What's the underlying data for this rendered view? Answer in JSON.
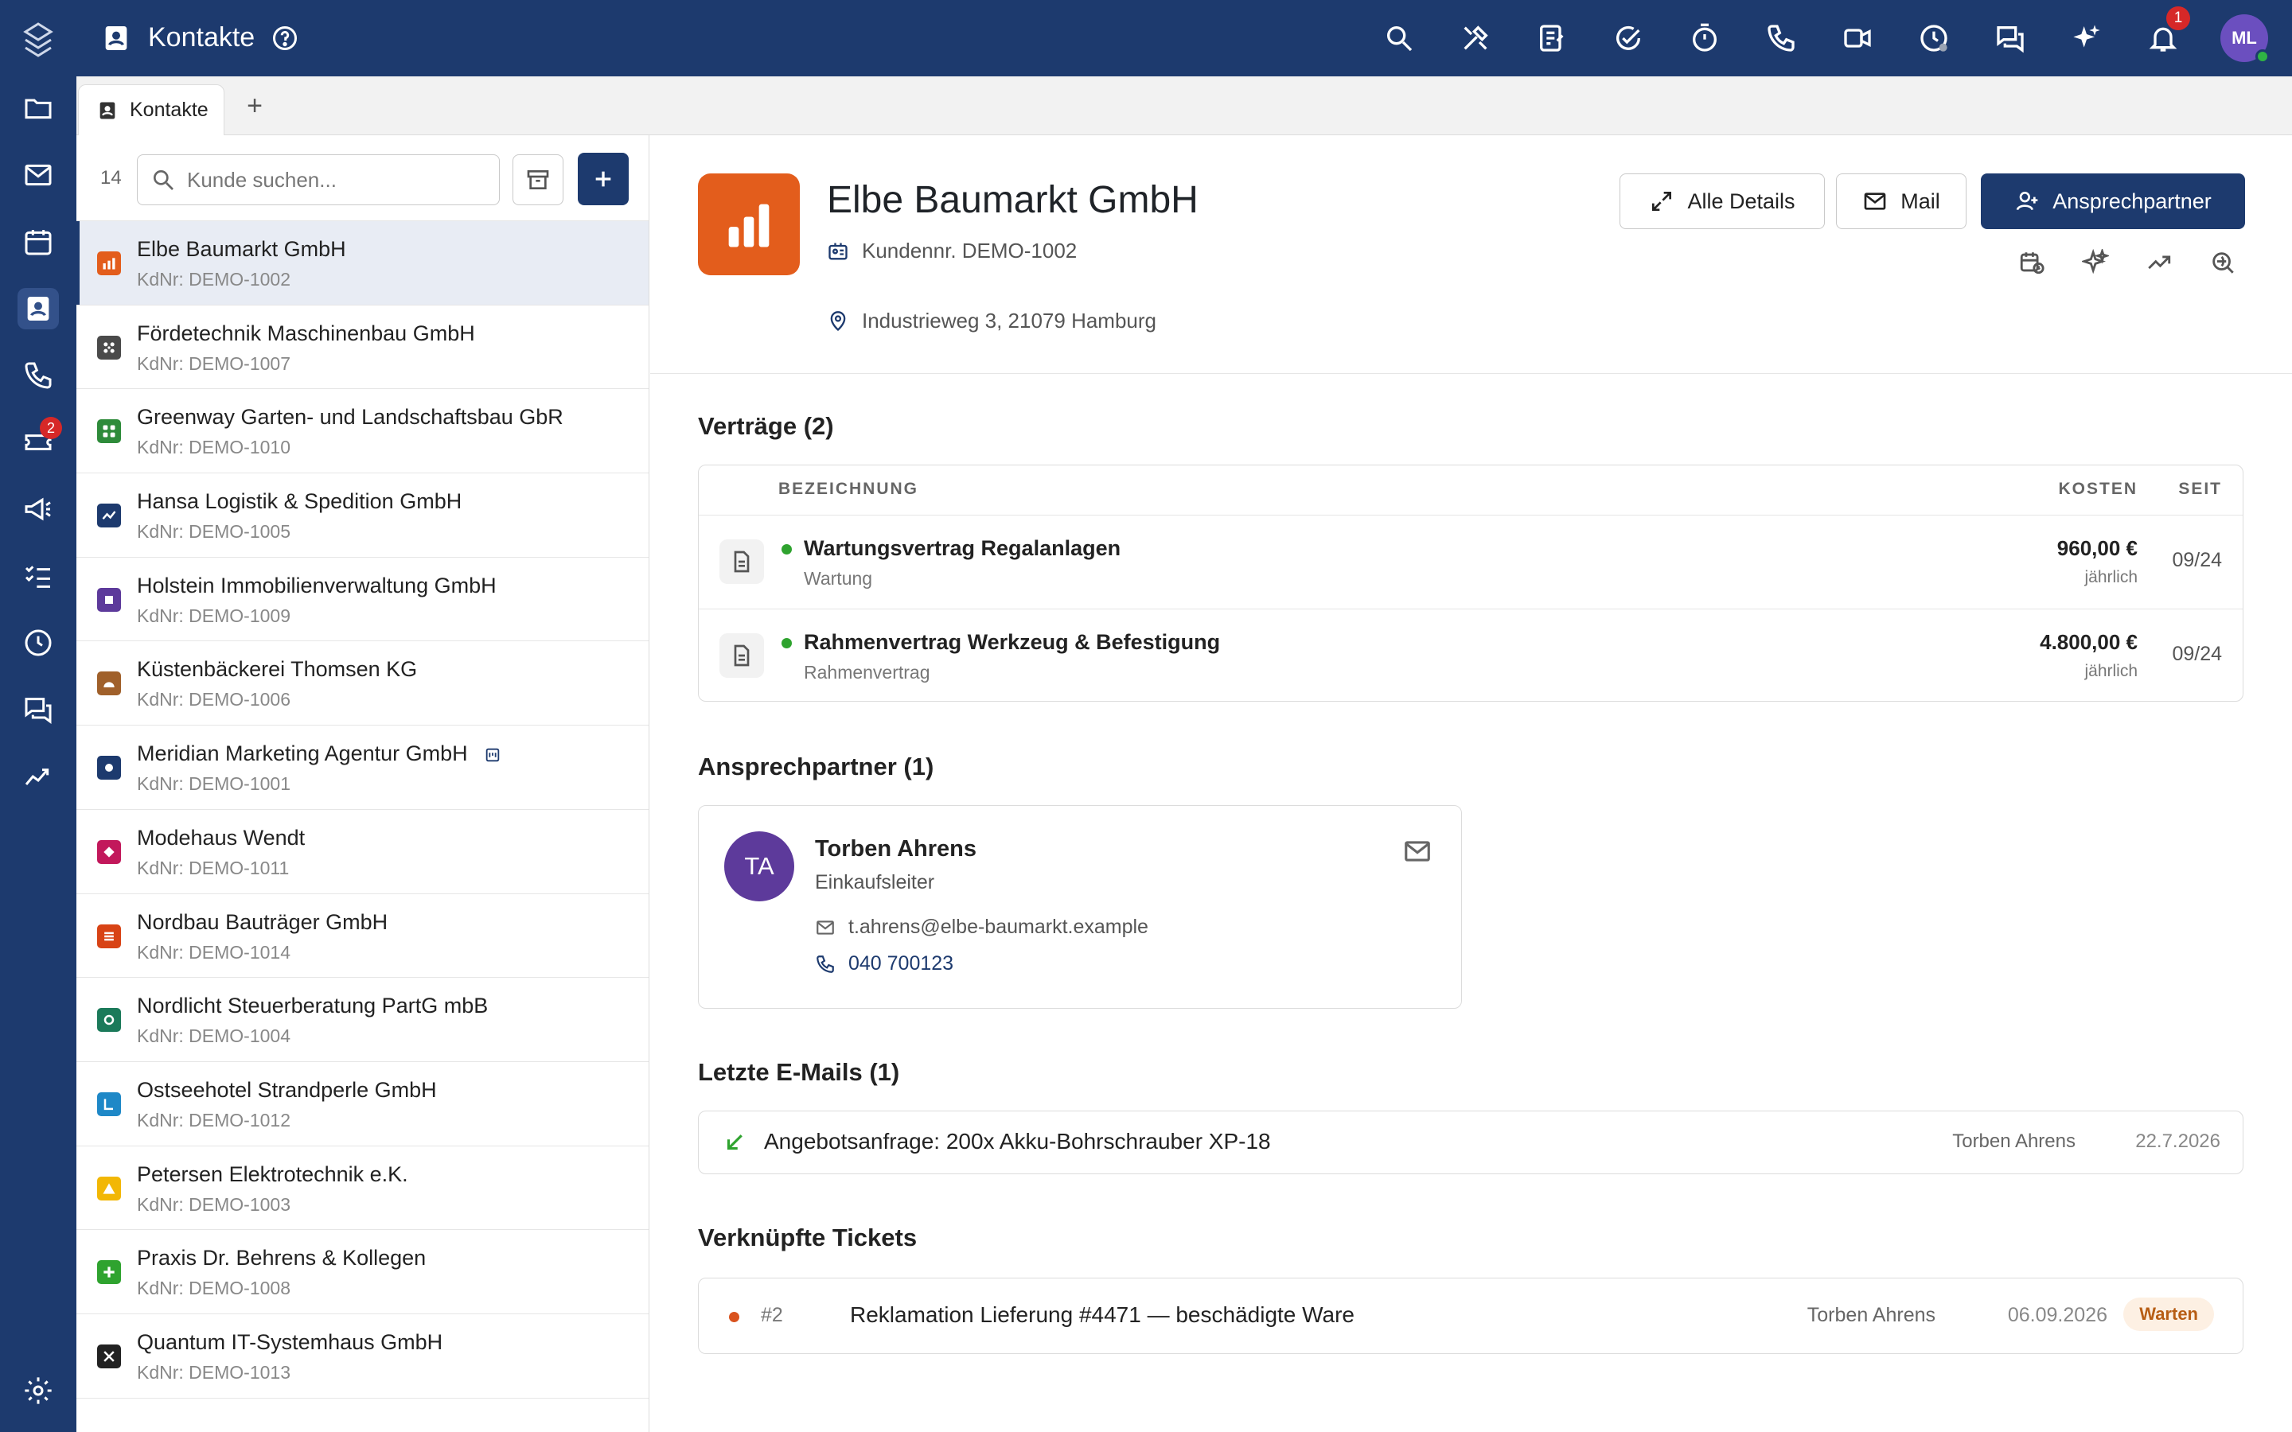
{
  "topbar": {
    "title": "Kontakte",
    "notifications_badge": "1",
    "user_initials": "ML",
    "icons": [
      "search-icon",
      "tools-icon",
      "notes-icon",
      "task-check-icon",
      "timer-icon",
      "phone-icon",
      "video-icon",
      "clock-status-icon",
      "chat-icon",
      "sparkle-ai-icon",
      "bell-icon"
    ]
  },
  "rail": {
    "tickets_badge": "2",
    "items": [
      "folder-icon",
      "mail-icon",
      "calendar-icon",
      "contacts-icon",
      "phone-icon",
      "ticket-icon",
      "megaphone-icon",
      "checklist-icon",
      "clock-icon",
      "chat-icon",
      "analytics-icon",
      "settings-icon"
    ]
  },
  "tabs": [
    {
      "label": "Kontakte"
    }
  ],
  "list": {
    "count": "14",
    "search_placeholder": "Kunde suchen...",
    "items": [
      {
        "name": "Elbe Baumarkt GmbH",
        "number": "KdNr: DEMO-1002",
        "color": "#e35d1c"
      },
      {
        "name": "Fördetechnik Maschinenbau GmbH",
        "number": "KdNr: DEMO-1007",
        "color": "#4a4a4a"
      },
      {
        "name": "Greenway Garten- und Landschaftsbau GbR",
        "number": "KdNr: DEMO-1010",
        "color": "#2e8b3a"
      },
      {
        "name": "Hansa Logistik & Spedition GmbH",
        "number": "KdNr: DEMO-1005",
        "color": "#1d3a6e"
      },
      {
        "name": "Holstein Immobilienverwaltung GmbH",
        "number": "KdNr: DEMO-1009",
        "color": "#5d3a9b"
      },
      {
        "name": "Küstenbäckerei Thomsen KG",
        "number": "KdNr: DEMO-1006",
        "color": "#a0602a"
      },
      {
        "name": "Meridian Marketing Agentur GmbH",
        "number": "KdNr: DEMO-1001",
        "color": "#1d3a6e"
      },
      {
        "name": "Modehaus Wendt",
        "number": "KdNr: DEMO-1011",
        "color": "#c2185b"
      },
      {
        "name": "Nordbau Bauträger GmbH",
        "number": "KdNr: DEMO-1014",
        "color": "#d84315"
      },
      {
        "name": "Nordlicht Steuerberatung PartG mbB",
        "number": "KdNr: DEMO-1004",
        "color": "#1b7a5a"
      },
      {
        "name": "Ostseehotel Strandperle GmbH",
        "number": "KdNr: DEMO-1012",
        "color": "#1e88c7"
      },
      {
        "name": "Petersen Elektrotechnik e.K.",
        "number": "KdNr: DEMO-1003",
        "color": "#f2b705"
      },
      {
        "name": "Praxis Dr. Behrens & Kollegen",
        "number": "KdNr: DEMO-1008",
        "color": "#2fa32f"
      },
      {
        "name": "Quantum IT-Systemhaus GmbH",
        "number": "KdNr: DEMO-1013",
        "color": "#222222"
      }
    ]
  },
  "detail": {
    "name": "Elbe Baumarkt GmbH",
    "customer_number": "Kundennr. DEMO-1002",
    "address": "Industrieweg 3, 21079 Hamburg",
    "buttons": {
      "details": "Alle Details",
      "mail": "Mail",
      "contact": "Ansprechpartner"
    },
    "contracts": {
      "title": "Verträge (2)",
      "headers": {
        "name": "BEZEICHNUNG",
        "cost": "KOSTEN",
        "since": "SEIT"
      },
      "rows": [
        {
          "name": "Wartungsvertrag Regalanlagen",
          "type": "Wartung",
          "cost": "960,00 €",
          "period": "jährlich",
          "since": "09/24"
        },
        {
          "name": "Rahmenvertrag Werkzeug & Befestigung",
          "type": "Rahmenvertrag",
          "cost": "4.800,00 €",
          "period": "jährlich",
          "since": "09/24"
        }
      ]
    },
    "contacts": {
      "title": "Ansprechpartner (1)",
      "person": {
        "initials": "TA",
        "name": "Torben Ahrens",
        "role": "Einkaufsleiter",
        "email": "t.ahrens@elbe-baumarkt.example",
        "phone": "040 700123"
      }
    },
    "emails": {
      "title": "Letzte E-Mails (1)",
      "items": [
        {
          "subject": "Angebotsanfrage: 200x Akku-Bohrschrauber XP-18",
          "from": "Torben Ahrens",
          "date": "22.7.2026"
        }
      ]
    },
    "tickets": {
      "title": "Verknüpfte Tickets",
      "items": [
        {
          "number": "#2",
          "title": "Reklamation Lieferung #4471 — beschädigte Ware",
          "from": "Torben Ahrens",
          "date": "06.09.2026",
          "status": "Warten"
        }
      ]
    }
  }
}
